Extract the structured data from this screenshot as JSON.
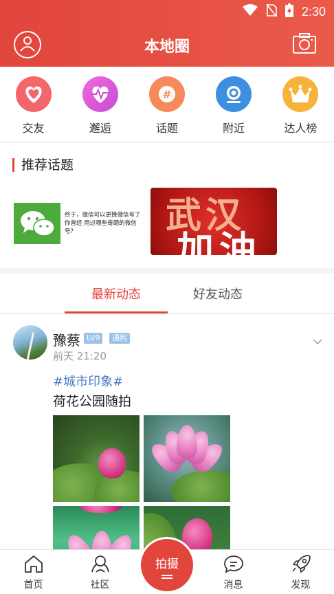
{
  "status_bar": {
    "time": "2:30"
  },
  "header": {
    "title": "本地圈"
  },
  "quick_nav": [
    {
      "label": "交友",
      "icon": "heart-icon",
      "color": "#f2666c"
    },
    {
      "label": "邂逅",
      "icon": "heartbeat-icon",
      "color": "#e05ad0"
    },
    {
      "label": "话题",
      "icon": "hashtag-icon",
      "color": "#f58a5a"
    },
    {
      "label": "附近",
      "icon": "location-icon",
      "color": "#3f8fe0"
    },
    {
      "label": "达人榜",
      "icon": "crown-icon",
      "color": "#f7b23a"
    }
  ],
  "recommend": {
    "title": "推荐话题",
    "topic1_text": "终于，微信可以更换微信号了 你曾经 用过哪些奇葩的微信号？",
    "topic2_text_line1": "武汉",
    "topic2_text_line2": "加油"
  },
  "tabs": {
    "active": "最新动态",
    "inactive": "好友动态"
  },
  "post": {
    "username": "豫蔡",
    "level_badge": "LV9",
    "role_badge": "通判",
    "time": "前天 21:20",
    "hashtag": "#城市印象#",
    "text": "荷花公园随拍"
  },
  "bottom_nav": {
    "home": "首页",
    "community": "社区",
    "shoot": "拍摄",
    "messages": "消息",
    "discover": "发现"
  },
  "colors": {
    "accent": "#e1453c",
    "link": "#4a7ac7",
    "badge": "#9cc2ea"
  }
}
